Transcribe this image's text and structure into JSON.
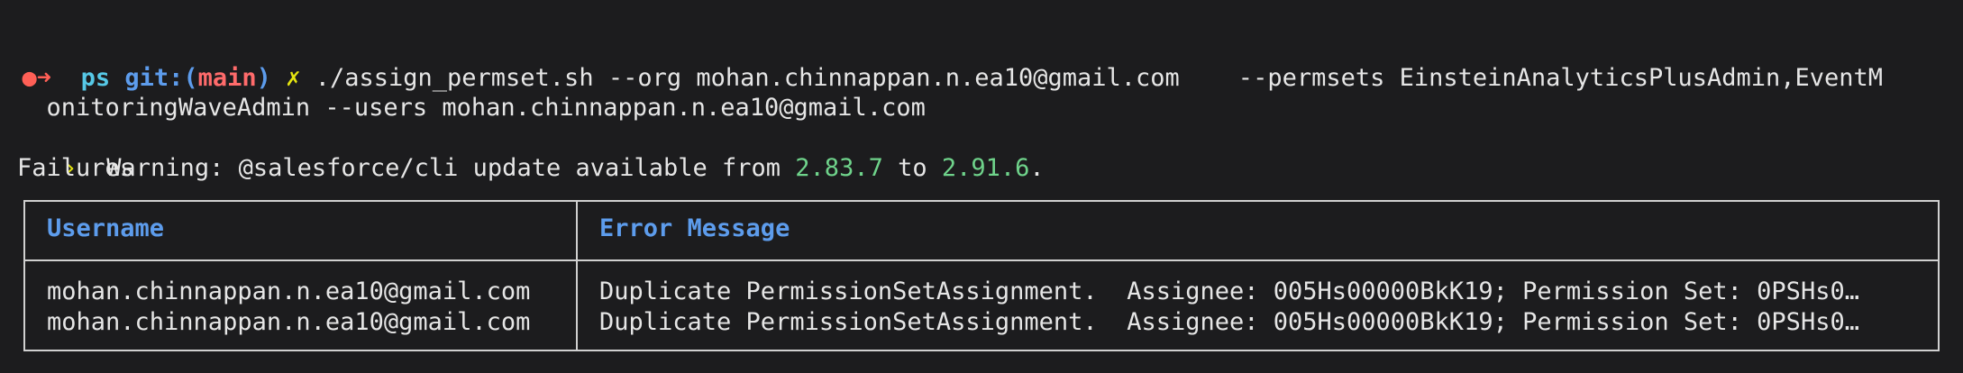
{
  "prompt": {
    "status_arrow": "➜",
    "dir": "ps",
    "git_prefix": "git:(",
    "branch": "main",
    "git_suffix": ")",
    "dirty_mark": "✗",
    "command_line1": "./assign_permset.sh --org mohan.chinnappan.n.ea10@gmail.com    --permsets EinsteinAnalyticsPlusAdmin,EventM",
    "command_line2": "onitoringWaveAdmin --users mohan.chinnappan.n.ea10@gmail.com"
  },
  "warning": {
    "marker": "›",
    "text_before": "  Warning: @salesforce/cli update available from ",
    "from_version": "2.83.7",
    "to_word": " to ",
    "to_version": "2.91.6",
    "end": "."
  },
  "failures_label": "Failures",
  "table": {
    "headers": [
      "Username",
      "Error Message"
    ],
    "rows": [
      {
        "username": "mohan.chinnappan.n.ea10@gmail.com",
        "error": "Duplicate PermissionSetAssignment.  Assignee: 005Hs00000BkK19; Permission Set: 0PSHs0…"
      },
      {
        "username": "mohan.chinnappan.n.ea10@gmail.com",
        "error": "Duplicate PermissionSetAssignment.  Assignee: 005Hs00000BkK19; Permission Set: 0PSHs0…"
      }
    ]
  },
  "colors": {
    "background": "#1c1c1e",
    "header_text": "#5d9cec",
    "version_green": "#6fd38b",
    "branch_red": "#ff6b6b"
  }
}
